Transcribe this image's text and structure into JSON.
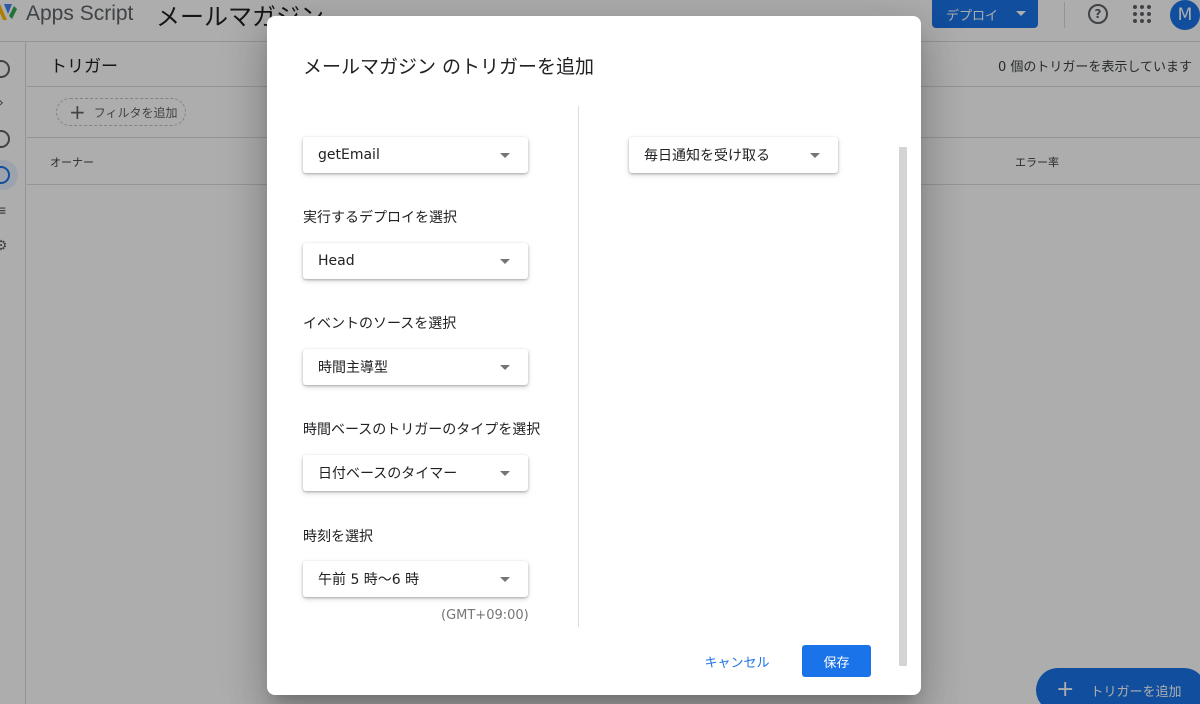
{
  "header": {
    "app_name": "Apps Script",
    "project_name": "メールマガジン",
    "deploy_label": "デプロイ",
    "help_icon": "help-circle-icon",
    "apps_icon": "apps-grid-icon",
    "avatar_letter": "M"
  },
  "sidebar": {
    "icons": [
      "info-icon",
      "code-icon",
      "history-icon",
      "triggers-icon",
      "executions-icon",
      "settings-icon"
    ],
    "active": "triggers-icon"
  },
  "page": {
    "title": "トリガー",
    "count_text": "0 個のトリガーを表示しています",
    "filter_label": "フィルタを追加",
    "columns": {
      "owner": "オーナー",
      "error_rate": "エラー率"
    },
    "fab_label": "トリガーを追加"
  },
  "dialog": {
    "title": "メールマガジン のトリガーを追加",
    "left": {
      "function_select": "getEmail",
      "deployment_label": "実行するデプロイを選択",
      "deployment_select": "Head",
      "event_source_label": "イベントのソースを選択",
      "event_source_select": "時間主導型",
      "trigger_type_label": "時間ベースのトリガーのタイプを選択",
      "trigger_type_select": "日付ベースのタイマー",
      "time_label": "時刻を選択",
      "time_select": "午前 5 時〜6 時",
      "timezone": "(GMT+09:00)"
    },
    "right": {
      "notification_select": "毎日通知を受け取る"
    },
    "buttons": {
      "cancel": "キャンセル",
      "save": "保存"
    }
  },
  "colors": {
    "primary": "#1a73e8",
    "overlay": "rgba(0,0,0,0.32)"
  }
}
